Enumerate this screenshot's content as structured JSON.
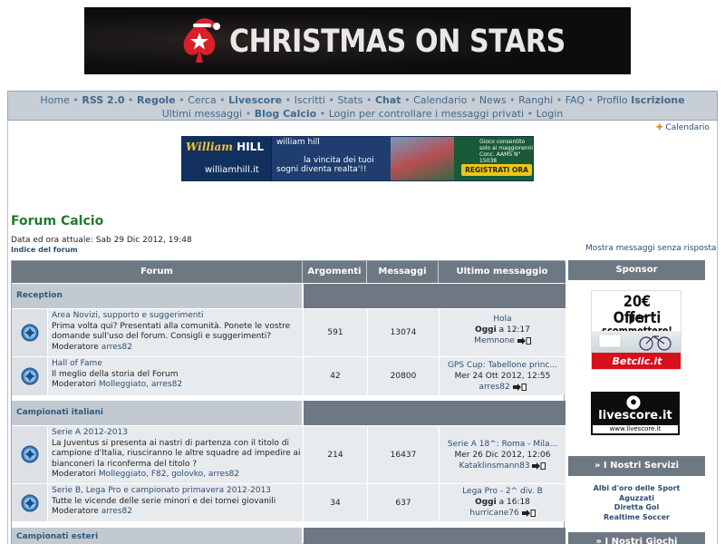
{
  "banner": {
    "text": "CHRISTMAS ON STARS"
  },
  "nav": {
    "row1": [
      "Home",
      "RSS 2.0",
      "Regole",
      "Cerca",
      "Livescore",
      "Iscritti",
      "Stats",
      "Chat",
      "Calendario",
      "News",
      "Ranghi",
      "FAQ",
      "Profilo",
      "Iscrizione"
    ],
    "row2": [
      "Ultimi messaggi",
      "Blog Calcio",
      "Login per controllare i messaggi privati",
      "Login"
    ]
  },
  "calendar_link": "Calendario",
  "ad": {
    "logo_a": "William",
    "logo_b": "HILL",
    "url": "williamhill.it",
    "line1": "william hill",
    "line2": "la vincita dei tuoi",
    "line3": "sogni diventa realta'!!",
    "legal": "Gioco consentito solo ai maggiorenni Conc. AAMS N° 15038",
    "cta": "REGISTRATI ORA"
  },
  "page": {
    "title": "Forum Calcio",
    "datetime": "Data ed ora attuale: Sab 29 Dic 2012, 19:48",
    "index": "Indice del forum",
    "unanswered": "Mostra messaggi senza risposta"
  },
  "table": {
    "headers": [
      "Forum",
      "Argomenti",
      "Messaggi",
      "Ultimo messaggio"
    ],
    "categories": [
      {
        "name": "Reception",
        "forums": [
          {
            "title": "Area Novizi, supporto e suggerimenti",
            "description": "Prima volta qui? Presentati alla comunità. Ponete le vostre domande sull'uso del forum. Consigli e suggerimenti?",
            "mods_label": "Moderatore",
            "mods": "arres82",
            "topics": "591",
            "posts": "13074",
            "last_title": "Hola",
            "last_day": "Oggi",
            "last_time": "a 12:17",
            "last_user": "Memnone"
          },
          {
            "title": "Hall of Fame",
            "description": "Il meglio della storia del Forum",
            "mods_label": "Moderatori",
            "mods": "Molleggiato, arres82",
            "topics": "42",
            "posts": "20800",
            "last_title": "GPS Cup: Tabellone princ...",
            "last_date": "Mer 24 Ott 2012, 12:55",
            "last_user": "arres82"
          }
        ]
      },
      {
        "name": "Campionati italiani",
        "forums": [
          {
            "title": "Serie A 2012-2013",
            "description": "La Juventus si presenta ai nastri di partenza con il titolo di campione d'Italia, riusciranno le altre squadre ad impedire ai bianconeri la riconferma del titolo ?",
            "mods_label": "Moderatori",
            "mods": "Molleggiato, F82, golovko, arres82",
            "topics": "214",
            "posts": "16437",
            "last_title": "Serie A 18^: Roma - Mila...",
            "last_date": "Mer 26 Dic 2012, 12:06",
            "last_user": "Kataklinsmann83"
          },
          {
            "title": "Serie B, Lega Pro e campionato primavera 2012-2013",
            "description": "Tutte le vicende delle serie minori e dei tornei giovanili",
            "mods_label": "Moderatore",
            "mods": "arres82",
            "topics": "34",
            "posts": "637",
            "last_title": "Lega Pro - 2^ div. B",
            "last_day": "Oggi",
            "last_time": "a 16:18",
            "last_user": "hurricane76"
          }
        ]
      },
      {
        "name": "Campionati esteri",
        "forums": []
      }
    ]
  },
  "sidebar": {
    "sponsor_title": "Sponsor",
    "betclic_big": "20€ Offerti",
    "betclic_small": "per scommettere!",
    "betclic_brand": "Betclic.it",
    "livescore_name": "livescore.it",
    "livescore_url": "www.livescore.it",
    "services_title": "» I Nostri Servizi",
    "services": [
      "Albi d'oro delle Sport",
      "Aguzzati",
      "Diretta Gol",
      "Realtime Soccer"
    ],
    "games_title": "» I Nostri Giochi"
  }
}
